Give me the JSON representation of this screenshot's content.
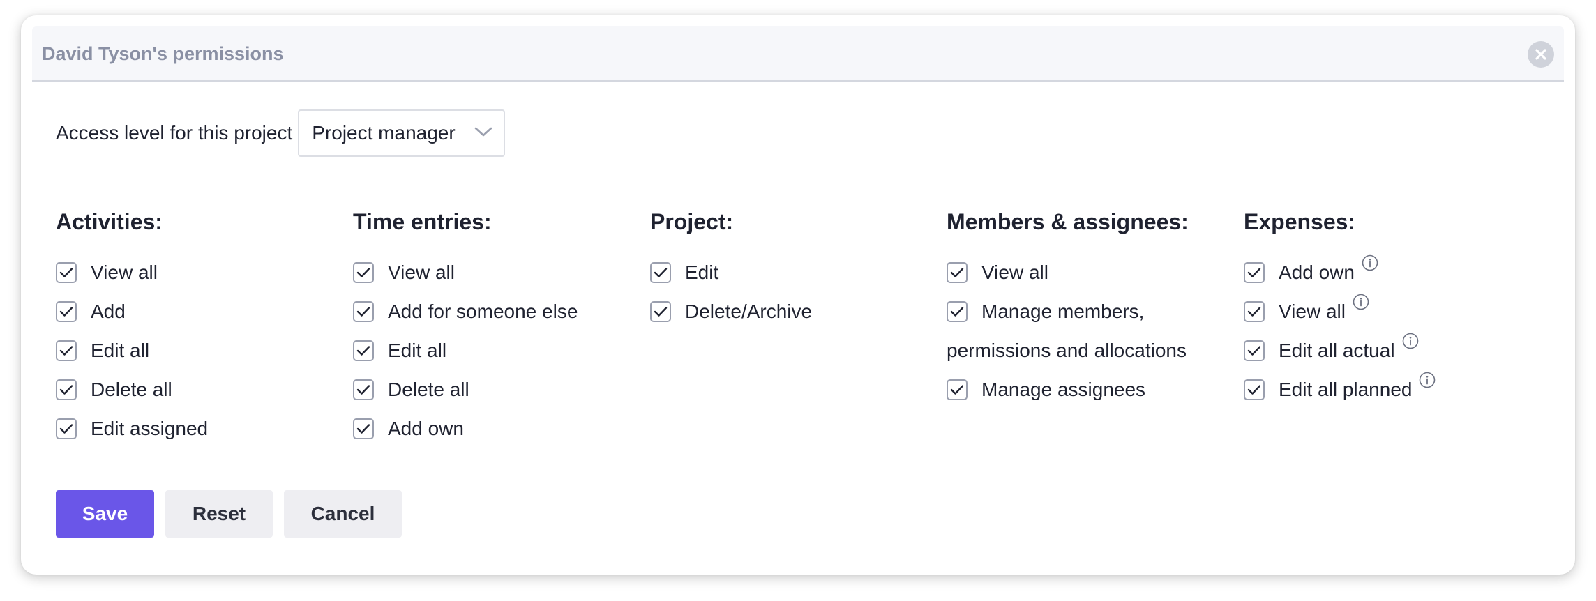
{
  "dialog": {
    "title": "David Tyson's permissions",
    "close_icon": "close-icon"
  },
  "access": {
    "label": "Access level for this project",
    "selected": "Project manager"
  },
  "columns": [
    {
      "heading": "Activities:",
      "items": [
        {
          "label": "View all",
          "checked": true
        },
        {
          "label": "Add",
          "checked": true
        },
        {
          "label": "Edit all",
          "checked": true
        },
        {
          "label": "Delete all",
          "checked": true
        },
        {
          "label": "Edit assigned",
          "checked": true
        }
      ]
    },
    {
      "heading": "Time entries:",
      "items": [
        {
          "label": "View all",
          "checked": true
        },
        {
          "label": "Add for someone else",
          "checked": true
        },
        {
          "label": "Edit all",
          "checked": true
        },
        {
          "label": "Delete all",
          "checked": true
        },
        {
          "label": "Add own",
          "checked": true
        }
      ]
    },
    {
      "heading": "Project:",
      "items": [
        {
          "label": "Edit",
          "checked": true
        },
        {
          "label": "Delete/Archive",
          "checked": true
        }
      ]
    },
    {
      "heading": "Members & assignees:",
      "items": [
        {
          "label": "View all",
          "checked": true
        },
        {
          "label_line1": "Manage members,",
          "label_line2": "permissions and allocations",
          "checked": true
        },
        {
          "label": "Manage assignees",
          "checked": true
        }
      ]
    },
    {
      "heading": "Expenses:",
      "items": [
        {
          "label": "Add own",
          "checked": true,
          "info": true
        },
        {
          "label": "View all",
          "checked": true,
          "info": true
        },
        {
          "label": "Edit all actual",
          "checked": true,
          "info": true
        },
        {
          "label": "Edit all planned",
          "checked": true,
          "info": true
        }
      ]
    }
  ],
  "buttons": {
    "save": "Save",
    "reset": "Reset",
    "cancel": "Cancel"
  },
  "colors": {
    "primary": "#6a56e8",
    "secondary_button": "#eeeef2",
    "header_bg": "#f6f7fa",
    "title_text": "#8a90a4"
  }
}
